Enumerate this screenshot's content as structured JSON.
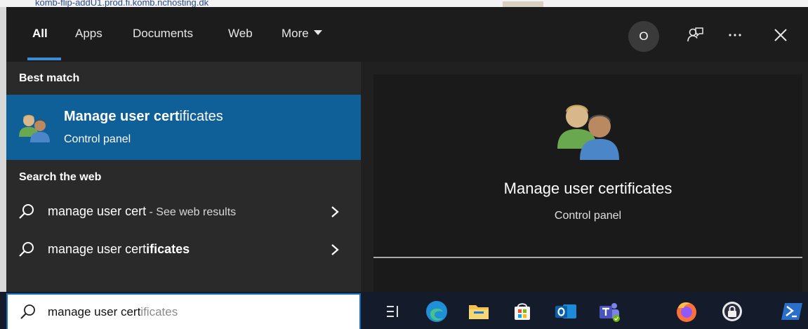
{
  "background": {
    "text": "komb-flip-addU1.prod.fi.komb.nchosting.dk"
  },
  "tabs": [
    {
      "label": "All",
      "active": true
    },
    {
      "label": "Apps",
      "active": false
    },
    {
      "label": "Documents",
      "active": false
    },
    {
      "label": "Web",
      "active": false
    },
    {
      "label": "More",
      "active": false
    }
  ],
  "header": {
    "avatar_initial": "O",
    "icons": [
      "feedback-icon",
      "more-options-icon",
      "close-icon"
    ]
  },
  "results": {
    "best_match_label": "Best match",
    "best_match": {
      "title_bold": "Manage user cert",
      "title_rest": "ificates",
      "subtitle": "Control panel",
      "icon": "users-icon"
    },
    "search_web_label": "Search the web",
    "web_items": [
      {
        "text": "manage user cert",
        "bold": "",
        "suffix": " - See web results"
      },
      {
        "text": "manage user cert",
        "bold": "ificates",
        "suffix": ""
      }
    ]
  },
  "preview": {
    "title": "Manage user certificates",
    "subtitle": "Control panel",
    "icon": "users-icon"
  },
  "search": {
    "typed": "manage user cert",
    "suggestion": "ificates"
  },
  "taskbar": {
    "icons": [
      "task-view-icon",
      "edge-icon",
      "file-explorer-icon",
      "store-icon",
      "outlook-icon",
      "teams-icon",
      "firefox-icon",
      "keepass-icon",
      "powershell-icon"
    ]
  },
  "colors": {
    "accent": "#0f5f99",
    "underline": "#3b8cd6",
    "panel": "#202020"
  }
}
